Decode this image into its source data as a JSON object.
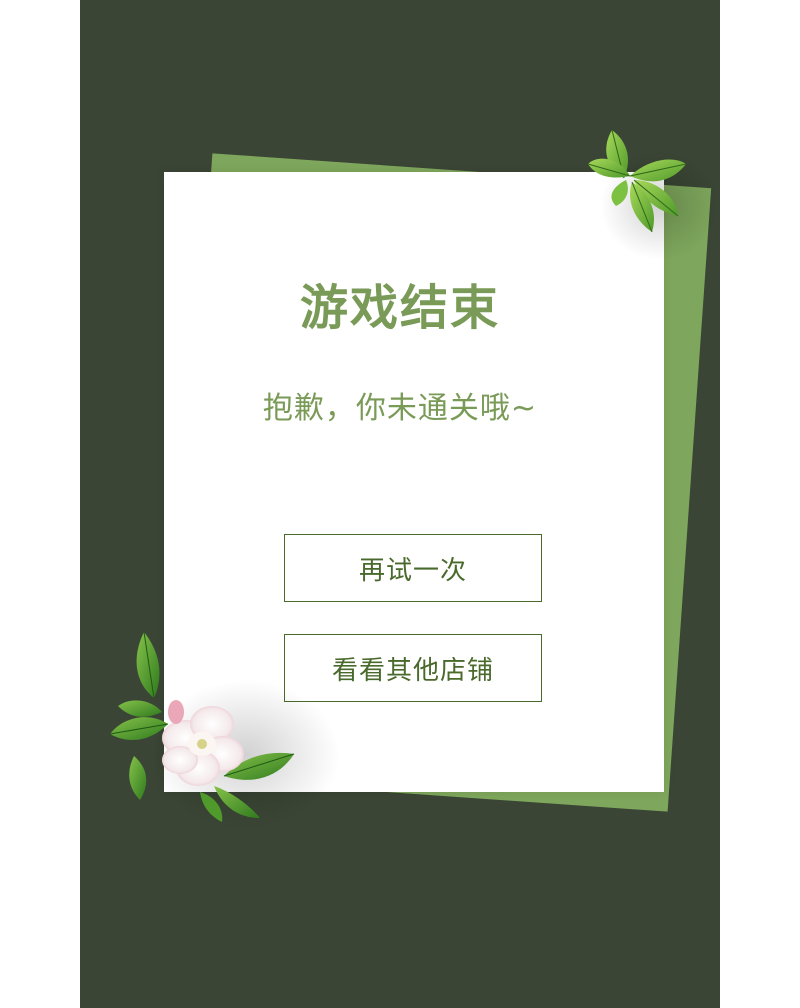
{
  "game_over": {
    "title": "游戏结束",
    "subtitle": "抱歉，你未通关哦~",
    "retry_label": "再试一次",
    "shop_label": "看看其他店铺"
  },
  "colors": {
    "background": "#3a4535",
    "card": "#ffffff",
    "back_paper": "#7ea65c",
    "text_green": "#7a9a57",
    "button_border": "#4a6a2c"
  },
  "decorations": {
    "top_right": "leaves-icon",
    "bottom_left": "flower-with-leaves-icon"
  }
}
